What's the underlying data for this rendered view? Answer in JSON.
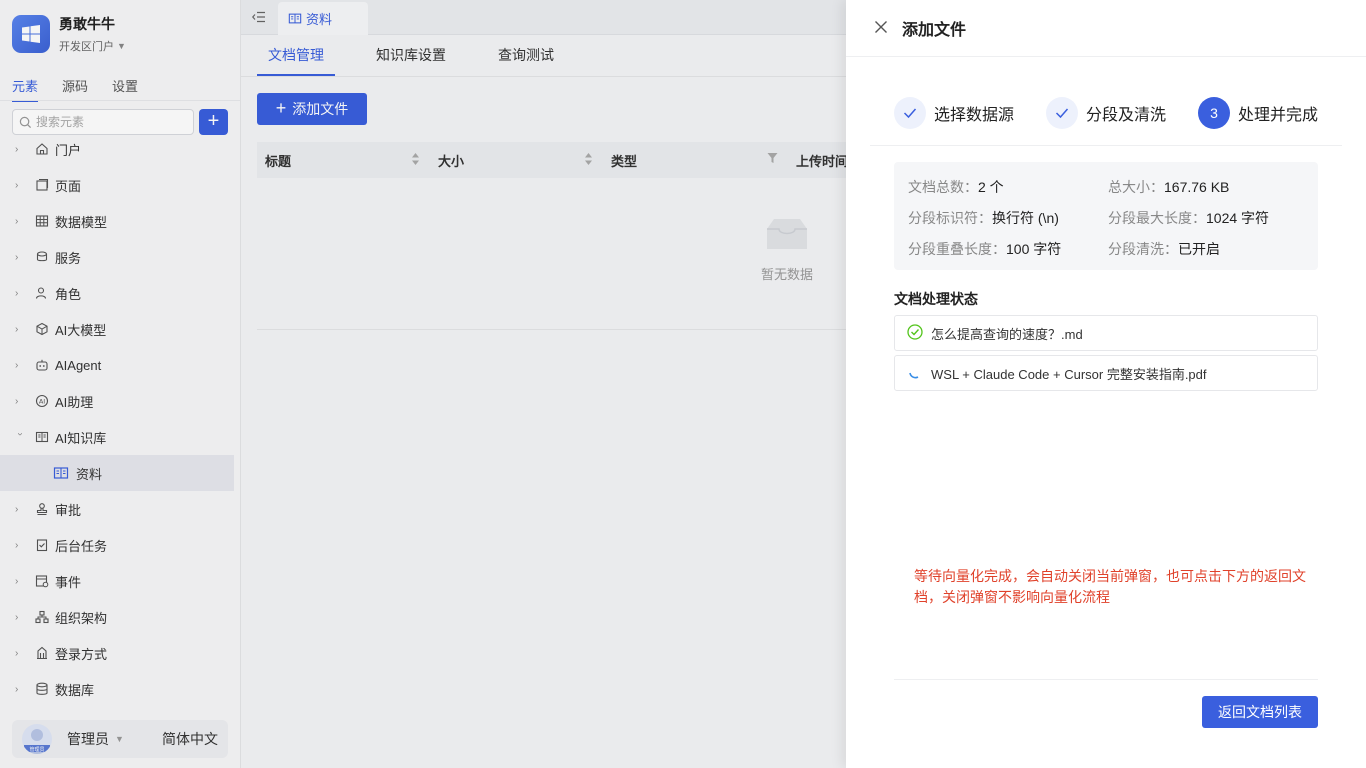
{
  "sidebar": {
    "brand_name": "勇敢牛牛",
    "brand_sub": "开发区门户",
    "tabs": [
      "元素",
      "源码",
      "设置"
    ],
    "search_placeholder": "搜索元素",
    "add_label": "+",
    "items": [
      {
        "label": "门户",
        "icon": "home-icon"
      },
      {
        "label": "页面",
        "icon": "page-icon"
      },
      {
        "label": "数据模型",
        "icon": "table-icon"
      },
      {
        "label": "服务",
        "icon": "service-icon"
      },
      {
        "label": "角色",
        "icon": "role-icon"
      },
      {
        "label": "AI大模型",
        "icon": "model-icon"
      },
      {
        "label": "AIAgent",
        "icon": "robot-icon"
      },
      {
        "label": "AI助理",
        "icon": "assistant-icon"
      },
      {
        "label": "AI知识库",
        "icon": "book-icon"
      },
      {
        "label": "资料",
        "icon": "book-icon",
        "child": true
      },
      {
        "label": "审批",
        "icon": "stamp-icon"
      },
      {
        "label": "后台任务",
        "icon": "task-icon"
      },
      {
        "label": "事件",
        "icon": "event-icon"
      },
      {
        "label": "组织架构",
        "icon": "org-icon"
      },
      {
        "label": "登录方式",
        "icon": "login-icon"
      },
      {
        "label": "数据库",
        "icon": "database-icon"
      }
    ],
    "user": {
      "name": "管理员",
      "avatar_text": "管理员",
      "language": "简体中文"
    }
  },
  "main": {
    "doc_tab": "资料",
    "subtabs": [
      "文档管理",
      "知识库设置",
      "查询测试"
    ],
    "add_file_label": "添加文件",
    "columns": [
      "标题",
      "大小",
      "类型",
      "上传时间"
    ],
    "empty_text": "暂无数据"
  },
  "drawer": {
    "title": "添加文件",
    "steps": [
      {
        "label": "选择数据源",
        "state": "done"
      },
      {
        "label": "分段及清洗",
        "state": "done"
      },
      {
        "label": "处理并完成",
        "state": "active",
        "number": "3"
      }
    ],
    "summary": [
      {
        "key": "文档总数：",
        "value": "2 个"
      },
      {
        "key": "总大小：",
        "value": "167.76 KB"
      },
      {
        "key": "分段标识符：",
        "value": "换行符 (\\n)"
      },
      {
        "key": "分段最大长度：",
        "value": "1024 字符"
      },
      {
        "key": "分段重叠长度：",
        "value": "100 字符"
      },
      {
        "key": "分段清洗：",
        "value": "已开启"
      }
    ],
    "status_title": "文档处理状态",
    "files": [
      {
        "name": "怎么提高查询的速度？.md",
        "status": "done"
      },
      {
        "name": "WSL + Claude Code + Cursor 完整安装指南.pdf",
        "status": "processing"
      }
    ],
    "hint": "等待向量化完成，会自动关闭当前弹窗，也可点击下方的返回文档，关闭弹窗不影响向量化流程",
    "back_label": "返回文档列表"
  },
  "colors": {
    "accent": "#3a5fde",
    "hint": "#e0422b",
    "success": "#52c41a"
  }
}
